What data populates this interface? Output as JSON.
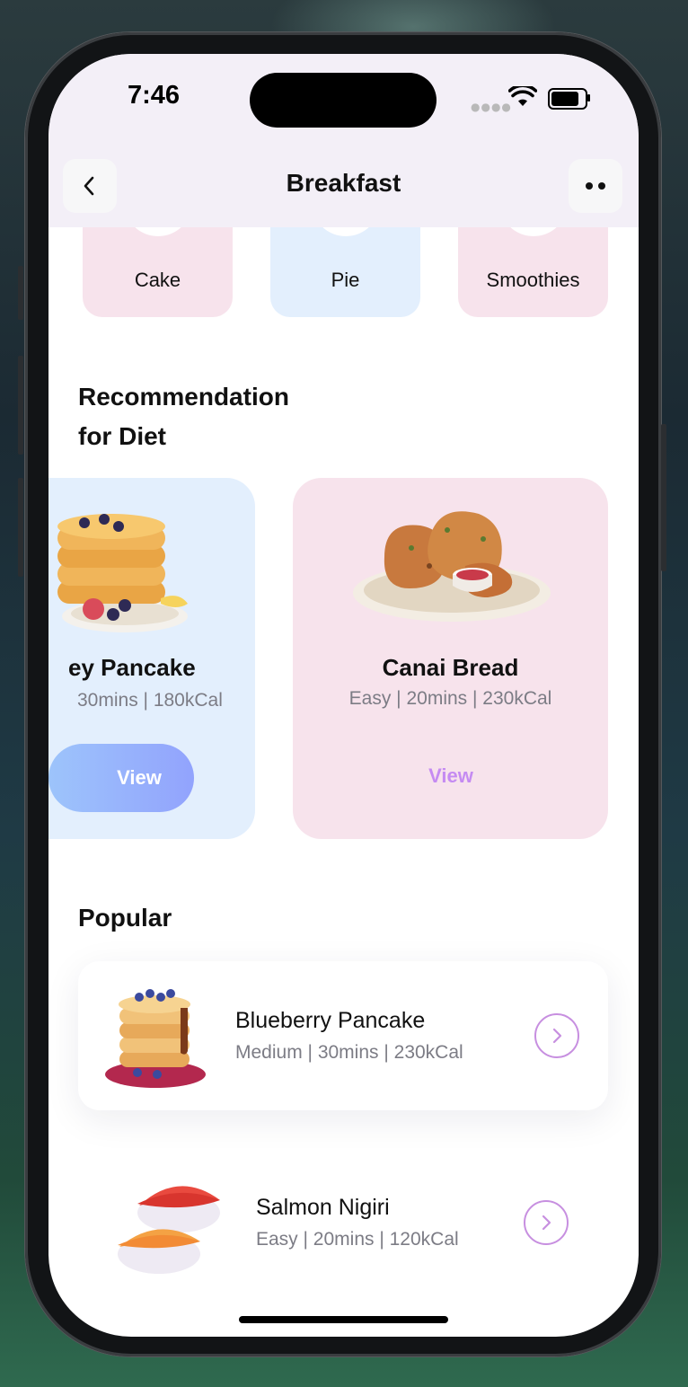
{
  "status": {
    "time": "7:46"
  },
  "header": {
    "title": "Breakfast"
  },
  "categories": [
    {
      "label": "Cake",
      "color": "#f7e3ec"
    },
    {
      "label": "Pie",
      "color": "#e3effd"
    },
    {
      "label": "Smoothies",
      "color": "#f7e3ec"
    }
  ],
  "recommendation": {
    "heading_line1": "Recommendation",
    "heading_line2": "for Diet",
    "items": [
      {
        "name": "ey Pancake",
        "meta": "30mins | 180kCal",
        "button": "View",
        "color": "#e3effd"
      },
      {
        "name": "Canai Bread",
        "meta": "Easy | 20mins | 230kCal",
        "button": "View",
        "color": "#f7e3ec"
      }
    ]
  },
  "popular": {
    "heading": "Popular",
    "items": [
      {
        "name": "Blueberry Pancake",
        "meta": "Medium | 30mins | 230kCal"
      },
      {
        "name": "Salmon Nigiri",
        "meta": "Easy | 20mins | 120kCal"
      }
    ]
  },
  "colors": {
    "accent": "#c78fe0",
    "view_gradient_start": "#9dc4fb",
    "view_gradient_end": "#92a3fd"
  }
}
